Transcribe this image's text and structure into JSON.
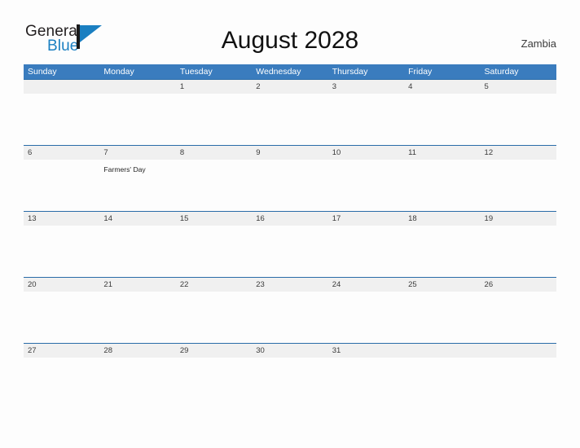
{
  "brand": {
    "name_top": "General",
    "name_bottom": "Blue",
    "flag_icon": "blue-triangle-flag-icon",
    "color_blue": "#1a7fc1",
    "color_dark": "#231f20"
  },
  "header": {
    "title": "August 2028",
    "country": "Zambia"
  },
  "calendar": {
    "accent_color": "#3a7cbe",
    "row_line_color": "#2a6ca8",
    "date_band_color": "#f0f0f0",
    "weekdays": [
      "Sunday",
      "Monday",
      "Tuesday",
      "Wednesday",
      "Thursday",
      "Friday",
      "Saturday"
    ],
    "weeks": [
      {
        "days": [
          {
            "date": "",
            "event": ""
          },
          {
            "date": "",
            "event": ""
          },
          {
            "date": "1",
            "event": ""
          },
          {
            "date": "2",
            "event": ""
          },
          {
            "date": "3",
            "event": ""
          },
          {
            "date": "4",
            "event": ""
          },
          {
            "date": "5",
            "event": ""
          }
        ]
      },
      {
        "days": [
          {
            "date": "6",
            "event": ""
          },
          {
            "date": "7",
            "event": "Farmers' Day"
          },
          {
            "date": "8",
            "event": ""
          },
          {
            "date": "9",
            "event": ""
          },
          {
            "date": "10",
            "event": ""
          },
          {
            "date": "11",
            "event": ""
          },
          {
            "date": "12",
            "event": ""
          }
        ]
      },
      {
        "days": [
          {
            "date": "13",
            "event": ""
          },
          {
            "date": "14",
            "event": ""
          },
          {
            "date": "15",
            "event": ""
          },
          {
            "date": "16",
            "event": ""
          },
          {
            "date": "17",
            "event": ""
          },
          {
            "date": "18",
            "event": ""
          },
          {
            "date": "19",
            "event": ""
          }
        ]
      },
      {
        "days": [
          {
            "date": "20",
            "event": ""
          },
          {
            "date": "21",
            "event": ""
          },
          {
            "date": "22",
            "event": ""
          },
          {
            "date": "23",
            "event": ""
          },
          {
            "date": "24",
            "event": ""
          },
          {
            "date": "25",
            "event": ""
          },
          {
            "date": "26",
            "event": ""
          }
        ]
      },
      {
        "days": [
          {
            "date": "27",
            "event": ""
          },
          {
            "date": "28",
            "event": ""
          },
          {
            "date": "29",
            "event": ""
          },
          {
            "date": "30",
            "event": ""
          },
          {
            "date": "31",
            "event": ""
          },
          {
            "date": "",
            "event": ""
          },
          {
            "date": "",
            "event": ""
          }
        ]
      }
    ]
  }
}
